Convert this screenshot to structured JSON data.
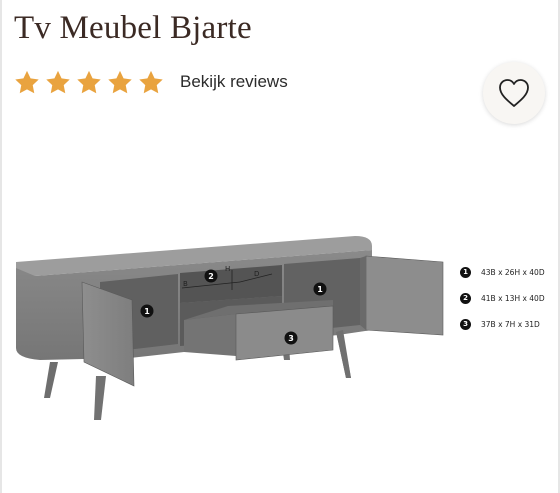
{
  "product": {
    "title": "Tv Meubel Bjarte",
    "rating": {
      "stars": 5,
      "max": 5,
      "star_color": "#e9a33f",
      "link_label": "Bekijk reviews"
    },
    "wishlist_icon": "heart-icon"
  },
  "diagram": {
    "labels": {
      "b": "B",
      "h": "H",
      "d": "D"
    },
    "markers": [
      "1",
      "2",
      "1",
      "3"
    ]
  },
  "dimensions": [
    {
      "num": "1",
      "text": "43B x 26H x 40D"
    },
    {
      "num": "2",
      "text": "41B x 13H x 40D"
    },
    {
      "num": "3",
      "text": "37B x 7H x 31D"
    }
  ],
  "colors": {
    "title": "#3b2a24",
    "accent_star": "#e9a33f",
    "wishlist_bg": "#f8f6f3"
  }
}
